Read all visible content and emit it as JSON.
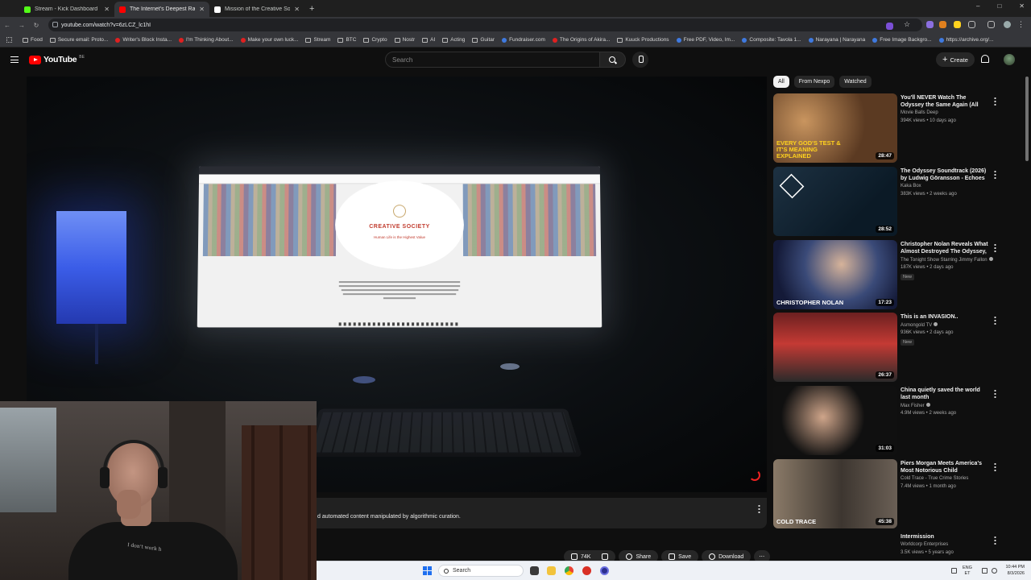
{
  "browser": {
    "tabs": [
      {
        "title": "Stream - Kick Dashboard",
        "favicon_color": "#53fc18",
        "active": false
      },
      {
        "title": "The Internet's Deepest Rab",
        "favicon_color": "#ff0000",
        "active": true
      },
      {
        "title": "Mission of the Creative Society",
        "favicon_color": "#ffffff",
        "active": false
      }
    ],
    "new_tab_label": "+",
    "url": "youtube.com/watch?v=6zLCZ_lc1hI",
    "bookmarks": [
      {
        "label": "Food",
        "icon": "folder-icon"
      },
      {
        "label": "Secure email: Proto...",
        "icon": "link-icon"
      },
      {
        "label": "Writer's Block Insta...",
        "icon": "youtube-icon"
      },
      {
        "label": "I'm Thinking About...",
        "icon": "youtube-icon"
      },
      {
        "label": "Make your own luck...",
        "icon": "youtube-icon"
      },
      {
        "label": "Stream",
        "icon": "folder-icon"
      },
      {
        "label": "BTC",
        "icon": "folder-icon"
      },
      {
        "label": "Crypto",
        "icon": "folder-icon"
      },
      {
        "label": "Nostr",
        "icon": "folder-icon"
      },
      {
        "label": "AI",
        "icon": "folder-icon"
      },
      {
        "label": "Acting",
        "icon": "folder-icon"
      },
      {
        "label": "Guitar",
        "icon": "folder-icon"
      },
      {
        "label": "Fundraiser.com",
        "icon": "site-icon"
      },
      {
        "label": "The Origins of Akira...",
        "icon": "youtube-icon"
      },
      {
        "label": "Kuuck Productions",
        "icon": "folder-icon"
      },
      {
        "label": "Free PDF, Video, Im...",
        "icon": "site-icon"
      },
      {
        "label": "Composite: Tavola 1...",
        "icon": "site-icon"
      },
      {
        "label": "Narayana | Narayana",
        "icon": "site-icon"
      },
      {
        "label": "Free Image Backgro...",
        "icon": "site-icon"
      },
      {
        "label": "https://archive.org/...",
        "icon": "site-icon"
      }
    ]
  },
  "youtube": {
    "logo_text": "YouTube",
    "logo_region": "BE",
    "search_placeholder": "Search",
    "create_label": "Create",
    "description_snippet": "d automated content manipulated by algorithmic curation.",
    "actions": {
      "likes": "74K",
      "share": "Share",
      "save": "Save",
      "download": "Download"
    },
    "monitor_page": {
      "title": "CREATIVE SOCIETY",
      "tagline": "Human Life is the Highest Value"
    },
    "chips": [
      "All",
      "From Nexpo",
      "Watched"
    ],
    "recommendations": [
      {
        "title": "You'll NEVER Watch The Odyssey the Same Again (All Gods, Hidde...",
        "channel": "Movie Balls Deep",
        "meta": "394K views • 10 days ago",
        "duration": "28:47",
        "badge": "",
        "thumb_text": "EVERY GOD'S TEST & IT'S MEANING EXPLAINED",
        "verified": false
      },
      {
        "title": "The Odyssey Soundtrack (2026) by Ludwig Göransson - Echoes of th...",
        "channel": "Kaka Box",
        "meta": "383K views • 2 weeks ago",
        "duration": "28:52",
        "badge": "",
        "thumb_text": "",
        "verified": false
      },
      {
        "title": "Christopher Nolan Reveals What Almost Destroyed The Odyssey, ...",
        "channel": "The Tonight Show Starring Jimmy Fallon",
        "meta": "187K views • 2 days ago",
        "duration": "17:23",
        "badge": "New",
        "thumb_text": "CHRISTOPHER NOLAN",
        "verified": true
      },
      {
        "title": "This is an INVASION..",
        "channel": "Asmongold TV",
        "meta": "936K views • 2 days ago",
        "duration": "26:37",
        "badge": "New",
        "thumb_text": "",
        "verified": true
      },
      {
        "title": "China quietly saved the world last month",
        "channel": "Max Fisher",
        "meta": "4.9M views • 2 weeks ago",
        "duration": "31:03",
        "badge": "",
        "thumb_text": "",
        "verified": true
      },
      {
        "title": "Piers Morgan Meets America's Most Notorious Child Psychopath",
        "channel": "Cold Trace - True Crime Stories",
        "meta": "7.4M views • 1 month ago",
        "duration": "45:38",
        "badge": "",
        "thumb_text": "COLD TRACE",
        "verified": false
      },
      {
        "title": "Intermission",
        "channel": "Worldcorp Enterprises",
        "meta": "3.5K views • 5 years ago",
        "duration": "",
        "badge": "",
        "thumb_text": "",
        "verified": false
      }
    ]
  },
  "webcam": {
    "shirt_text": "I don't work h"
  },
  "taskbar": {
    "search_label": "Search",
    "lang": "ENG",
    "region": "ET",
    "time": "10:44 PM",
    "date": "8/3/2026"
  }
}
